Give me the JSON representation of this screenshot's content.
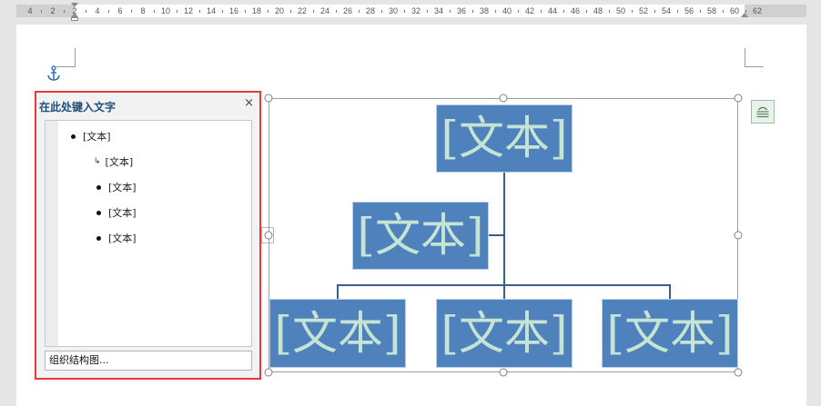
{
  "ruler": {
    "labels": [
      "4",
      "2",
      "2",
      "4",
      "6",
      "8",
      "10",
      "12",
      "14",
      "16",
      "18",
      "20",
      "22",
      "24",
      "26",
      "28",
      "30",
      "32",
      "34",
      "36",
      "38",
      "40",
      "42",
      "44",
      "46",
      "48",
      "50",
      "52",
      "54",
      "56",
      "58",
      "60",
      "62"
    ]
  },
  "text_pane": {
    "title": "在此处键入文字",
    "close_symbol": "×",
    "items": [
      {
        "text": "[文本]",
        "bullet": "dot"
      },
      {
        "text": "[文本]",
        "bullet": "arrow"
      },
      {
        "text": "[文本]",
        "bullet": "dot"
      },
      {
        "text": "[文本]",
        "bullet": "dot"
      },
      {
        "text": "[文本]",
        "bullet": "dot"
      }
    ],
    "footer": "组织结构图..."
  },
  "expand_symbol": "›",
  "smartart": {
    "top": "[文本]",
    "assistant": "[文本]",
    "children": [
      "[文本]",
      "[文本]",
      "[文本]"
    ],
    "box_color": "#4f81bd",
    "text_color": "#c6e4d4",
    "line_color": "#3a5f88"
  },
  "icons": {
    "anchor": "anchor-icon",
    "layout_options": "layout-options-icon"
  }
}
